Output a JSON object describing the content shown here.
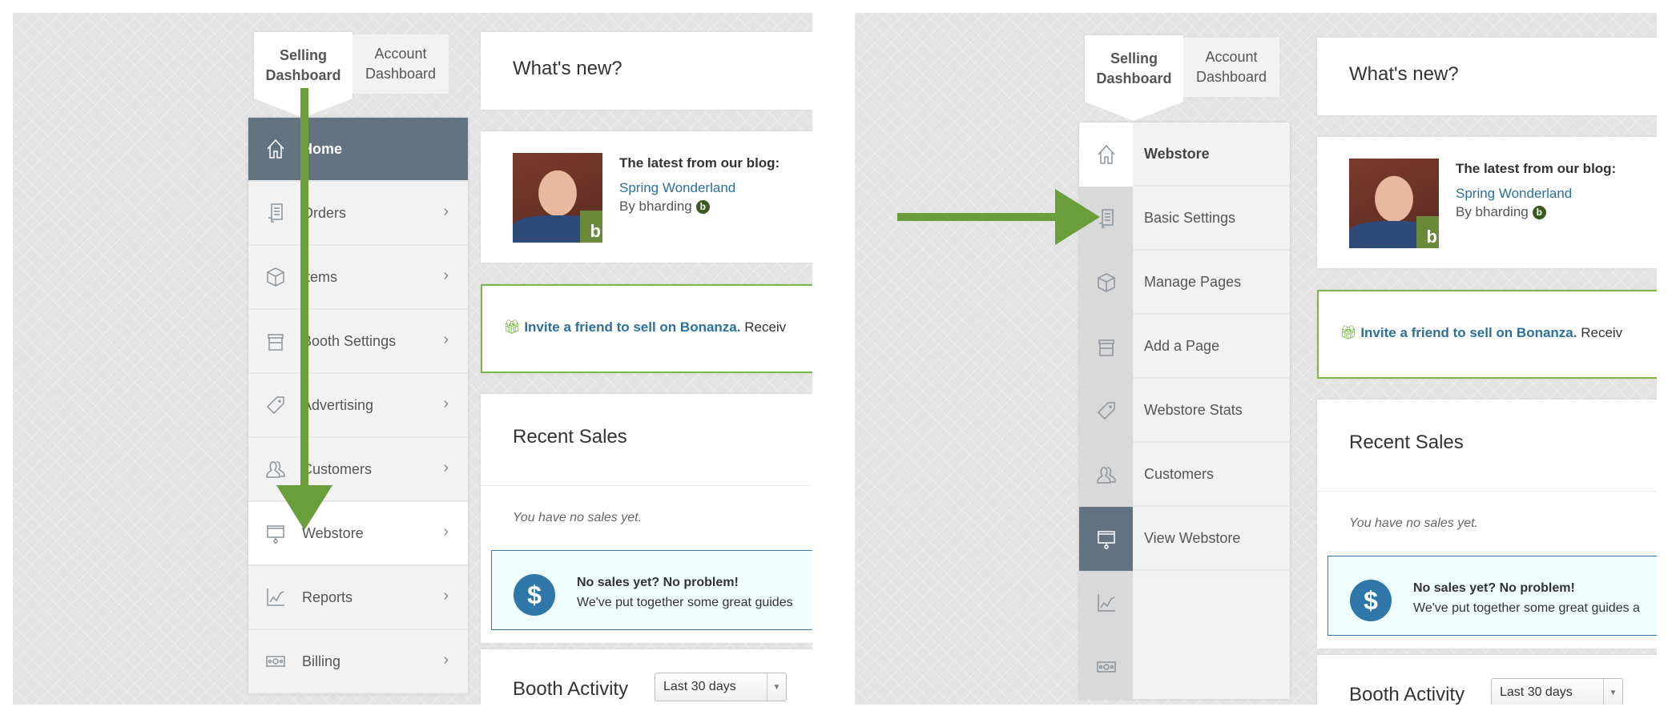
{
  "tabs": {
    "selling": "Selling Dashboard",
    "account": "Account Dashboard"
  },
  "left_sidebar": [
    {
      "label": "Home",
      "icon": "home-icon",
      "state": "active"
    },
    {
      "label": "Orders",
      "icon": "receipt-icon"
    },
    {
      "label": "Items",
      "icon": "box-icon"
    },
    {
      "label": "Booth Settings",
      "icon": "store-icon"
    },
    {
      "label": "Advertising",
      "icon": "tag-icon"
    },
    {
      "label": "Customers",
      "icon": "users-icon"
    },
    {
      "label": "Webstore",
      "icon": "monitor-icon",
      "state": "hover"
    },
    {
      "label": "Reports",
      "icon": "chart-icon"
    },
    {
      "label": "Billing",
      "icon": "money-icon"
    }
  ],
  "right_sidebar": {
    "icons": [
      "home-icon",
      "receipt-icon",
      "box-icon",
      "store-icon",
      "tag-icon",
      "users-icon",
      "monitor-icon",
      "chart-icon",
      "money-icon"
    ],
    "title": "Webstore",
    "items": [
      "Basic Settings",
      "Manage Pages",
      "Add a Page",
      "Webstore Stats",
      "Customers",
      "View Webstore"
    ]
  },
  "content": {
    "whats_new": "What's new?",
    "blog_heading": "The latest from our blog:",
    "blog_link": "Spring Wonderland",
    "blog_by": "By bharding",
    "invite_link": "Invite a friend to sell on Bonanza.",
    "invite_rest": " Receiv",
    "recent_sales": "Recent Sales",
    "no_sales": "You have no sales yet.",
    "promo_title": "No sales yet? No problem!",
    "promo_text_left": "We've put together some great guides",
    "promo_text_right": "We've put together some great guides a",
    "booth_activity": "Booth Activity",
    "range_select": "Last 30 days"
  },
  "colors": {
    "accent_green": "#6a9e3a",
    "active_nav": "#637381",
    "link_blue": "#2e6f9e",
    "promo_bg": "#eefcfd"
  }
}
